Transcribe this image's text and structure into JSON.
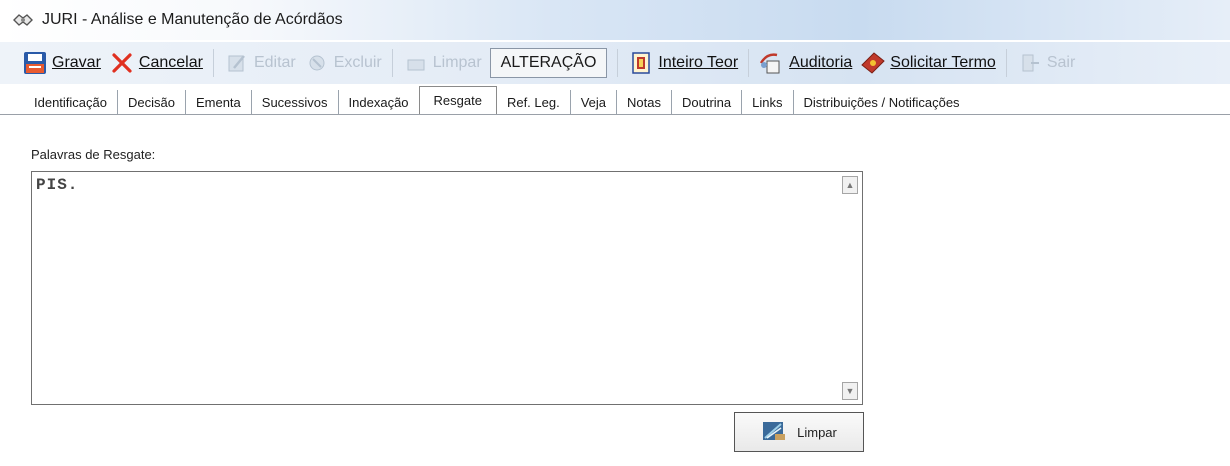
{
  "window": {
    "title": "JURI - Análise e Manutenção de Acórdãos",
    "icon": "handshake-icon"
  },
  "toolbar": {
    "gravar": "Gravar",
    "cancelar": "Cancelar",
    "editar": "Editar",
    "excluir": "Excluir",
    "limpar": "Limpar",
    "mode": "ALTERAÇÃO",
    "inteiro_teor": "Inteiro Teor",
    "auditoria": "Auditoria",
    "solicitar_termo": "Solicitar Termo",
    "sair": "Sair"
  },
  "tabs": [
    {
      "label": "Identificação"
    },
    {
      "label": "Decisão"
    },
    {
      "label": "Ementa"
    },
    {
      "label": "Sucessivos"
    },
    {
      "label": "Indexação"
    },
    {
      "label": "Resgate"
    },
    {
      "label": "Ref. Leg."
    },
    {
      "label": "Veja"
    },
    {
      "label": "Notas"
    },
    {
      "label": "Doutrina"
    },
    {
      "label": "Links"
    },
    {
      "label": "Distribuições / Notificações"
    }
  ],
  "active_tab": "Resgate",
  "resgate": {
    "label": "Palavras de Resgate:",
    "value": "PIS.",
    "limpar_button": "Limpar"
  },
  "colors": {
    "accent": "#d9e6f5",
    "cancel_red": "#e03020",
    "save_blue": "#2a5aa8"
  }
}
